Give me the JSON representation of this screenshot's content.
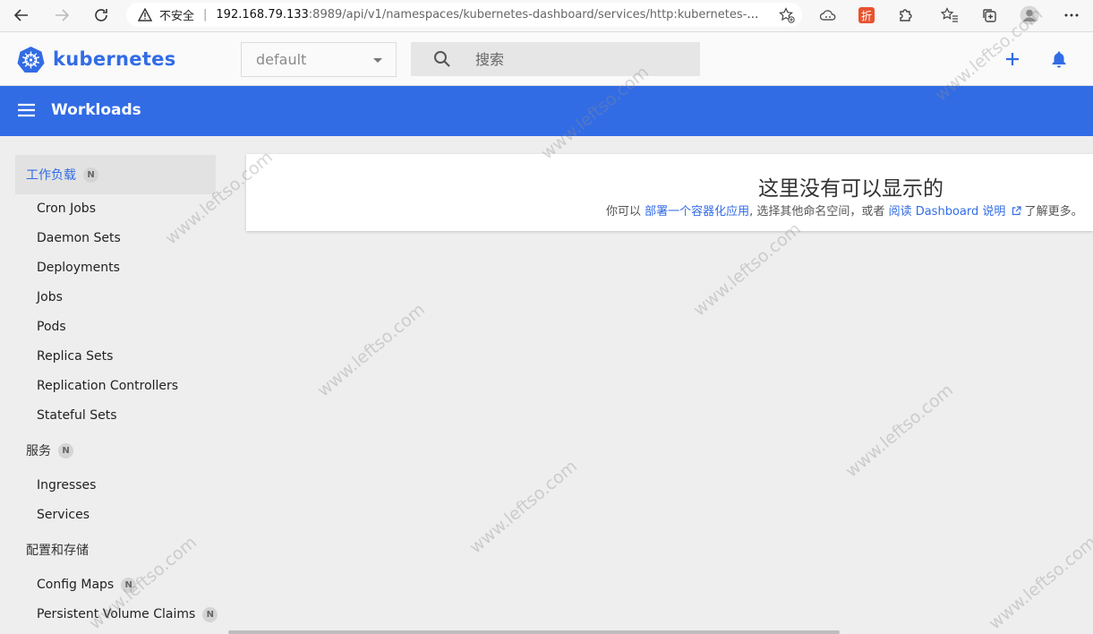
{
  "browser": {
    "insecure_label": "不安全",
    "url_host": "192.168.79.133",
    "url_rest": ":8989/api/v1/namespaces/kubernetes-dashboard/services/http:kubernetes-dashb..."
  },
  "header": {
    "logo_text": "kubernetes",
    "namespace": "default",
    "search_placeholder": "搜索"
  },
  "toolbar": {
    "title": "Workloads"
  },
  "sidebar": {
    "groups": [
      {
        "label": "工作负载",
        "badge": "N"
      },
      {
        "label": "服务",
        "badge": "N"
      },
      {
        "label": "配置和存储"
      }
    ],
    "workloads": [
      "Cron Jobs",
      "Daemon Sets",
      "Deployments",
      "Jobs",
      "Pods",
      "Replica Sets",
      "Replication Controllers",
      "Stateful Sets"
    ],
    "services": [
      "Ingresses",
      "Services"
    ],
    "config": [
      {
        "label": "Config Maps",
        "badge": "N"
      },
      {
        "label": "Persistent Volume Claims",
        "badge": "N"
      }
    ]
  },
  "empty_state": {
    "title": "这里没有可以显示的",
    "prefix": "你可以",
    "deploy_link": "部署一个容器化应用",
    "middle": ", 选择其他命名空间，或者",
    "docs_link": "阅读 Dashboard 说明",
    "suffix": "了解更多。"
  },
  "watermark": "www.leftso.com",
  "colors": {
    "brand": "#326ce5",
    "background": "#eeeeee"
  }
}
